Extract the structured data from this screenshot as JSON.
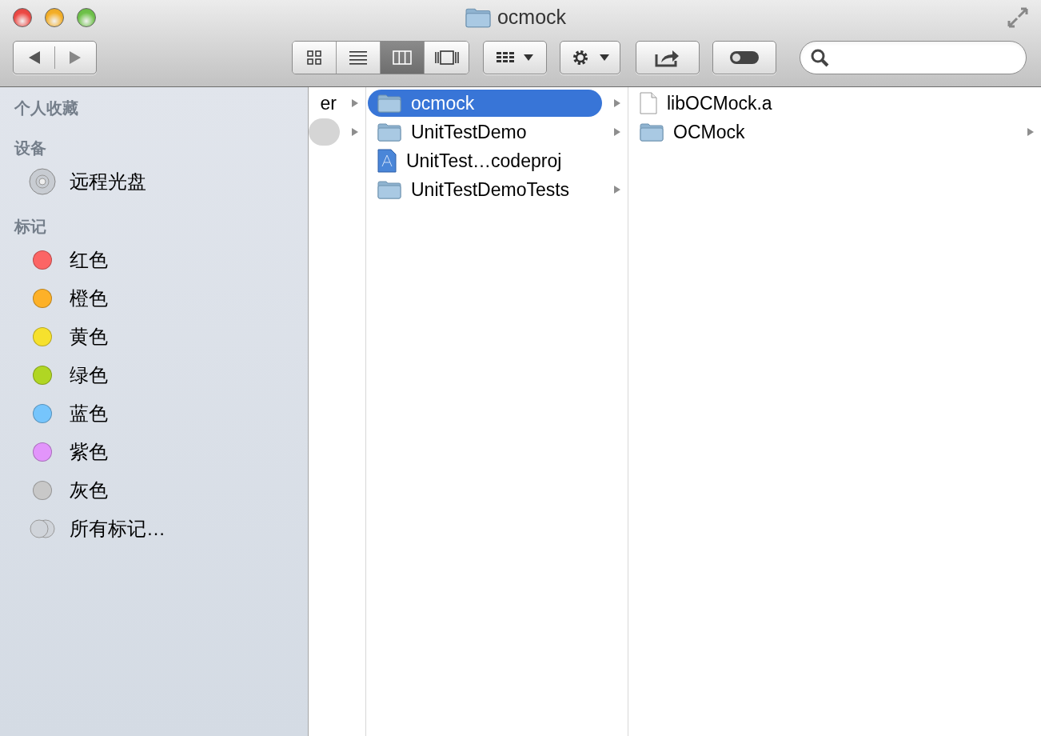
{
  "window": {
    "title": "ocmock"
  },
  "view_modes": [
    {
      "kind": "icons",
      "selected": false
    },
    {
      "kind": "list",
      "selected": false
    },
    {
      "kind": "columns",
      "selected": true
    },
    {
      "kind": "coverflow",
      "selected": false
    }
  ],
  "sidebar": {
    "sections": [
      {
        "heading": "个人收藏"
      },
      {
        "heading": "设备",
        "items": [
          {
            "kind": "disc",
            "label": "远程光盘"
          }
        ]
      },
      {
        "heading": "标记",
        "items": [
          {
            "kind": "tag",
            "label": "红色",
            "color": "#fc6565"
          },
          {
            "kind": "tag",
            "label": "橙色",
            "color": "#fdb128"
          },
          {
            "kind": "tag",
            "label": "黄色",
            "color": "#f6e12d"
          },
          {
            "kind": "tag",
            "label": "绿色",
            "color": "#b0d623"
          },
          {
            "kind": "tag",
            "label": "蓝色",
            "color": "#76c5fc"
          },
          {
            "kind": "tag",
            "label": "紫色",
            "color": "#e295fb"
          },
          {
            "kind": "tag",
            "label": "灰色",
            "color": "#c8c8c8"
          },
          {
            "kind": "all-tags",
            "label": "所有标记…"
          }
        ]
      }
    ]
  },
  "columns": [
    {
      "rows": [
        {
          "name": "er",
          "kind": "none",
          "selected": false,
          "has_children": true
        },
        {
          "kind": "none",
          "selected": true,
          "has_children": true
        }
      ]
    },
    {
      "rows": [
        {
          "name": "ocmock",
          "kind": "folder",
          "selected": true,
          "has_children": true
        },
        {
          "name": "UnitTestDemo",
          "kind": "folder",
          "selected": false,
          "has_children": true
        },
        {
          "name": "UnitTest…codeproj",
          "kind": "project",
          "selected": false,
          "has_children": false
        },
        {
          "name": "UnitTestDemoTests",
          "kind": "folder",
          "selected": false,
          "has_children": true
        }
      ]
    },
    {
      "rows": [
        {
          "name": "libOCMock.a",
          "kind": "file",
          "selected": false,
          "has_children": false
        },
        {
          "name": "OCMock",
          "kind": "folder",
          "selected": false,
          "has_children": true
        }
      ]
    }
  ]
}
